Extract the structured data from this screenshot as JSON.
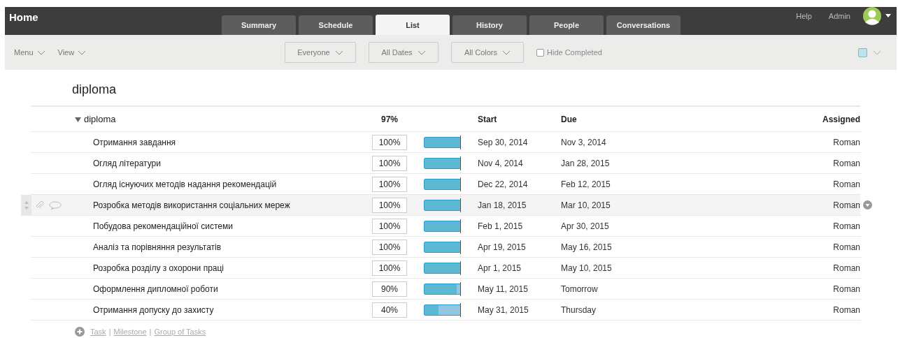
{
  "header": {
    "title": "Home",
    "tabs": [
      {
        "label": "Summary",
        "selected": false
      },
      {
        "label": "Schedule",
        "selected": false
      },
      {
        "label": "List",
        "selected": true
      },
      {
        "label": "History",
        "selected": false
      },
      {
        "label": "People",
        "selected": false
      },
      {
        "label": "Conversations",
        "selected": false
      }
    ],
    "links": [
      "Help",
      "Admin"
    ]
  },
  "toolbar": {
    "menus": [
      "Menu",
      "View"
    ],
    "filters": [
      "Everyone",
      "All Dates",
      "All Colors"
    ],
    "hide_completed": {
      "label": "Hide Completed",
      "checked": false
    }
  },
  "project_title": "diploma",
  "group": {
    "name": "diploma",
    "expanded": true,
    "percent": "97%",
    "columns": {
      "start": "Start",
      "due": "Due",
      "assigned": "Assigned"
    }
  },
  "tasks": [
    {
      "name": "Отримання завдання",
      "percent": "100%",
      "level": 1,
      "start": "Sep 30, 2014",
      "due": "Nov 3, 2014",
      "assigned": "Roman",
      "hovered": false
    },
    {
      "name": "Огляд літератури",
      "percent": "100%",
      "level": 1,
      "start": "Nov 4, 2014",
      "due": "Jan 28, 2015",
      "assigned": "Roman",
      "hovered": false
    },
    {
      "name": "Огляд існуючих методів надання рекомендацій",
      "percent": "100%",
      "level": 1,
      "start": "Dec 22, 2014",
      "due": "Feb 12, 2015",
      "assigned": "Roman",
      "hovered": false
    },
    {
      "name": "Розробка методів використання соціальних мереж",
      "percent": "100%",
      "level": 1,
      "start": "Jan 18, 2015",
      "due": "Mar 10, 2015",
      "assigned": "Roman",
      "hovered": true
    },
    {
      "name": "Побудова рекомендаційної системи",
      "percent": "100%",
      "level": 1,
      "start": "Feb 1, 2015",
      "due": "Apr 30, 2015",
      "assigned": "Roman",
      "hovered": false
    },
    {
      "name": "Аналіз та порівняння результатів",
      "percent": "100%",
      "level": 1,
      "start": "Apr 19, 2015",
      "due": "May 16, 2015",
      "assigned": "Roman",
      "hovered": false
    },
    {
      "name": "Розробка розділу з охорони праці",
      "percent": "100%",
      "level": 1,
      "start": "Apr 1, 2015",
      "due": "May 10, 2015",
      "assigned": "Roman",
      "hovered": false
    },
    {
      "name": "Оформлення дипломної роботи",
      "percent": "90%",
      "level": 0.9,
      "start": "May 11, 2015",
      "due": "Tomorrow",
      "assigned": "Roman",
      "hovered": false
    },
    {
      "name": "Отримання допуску до захисту",
      "percent": "40%",
      "level": 0.4,
      "start": "May 31, 2015",
      "due": "Thursday",
      "assigned": "Roman",
      "hovered": false
    }
  ],
  "add_links": [
    "Task",
    "Milestone",
    "Group of Tasks"
  ],
  "add_separator": "|"
}
